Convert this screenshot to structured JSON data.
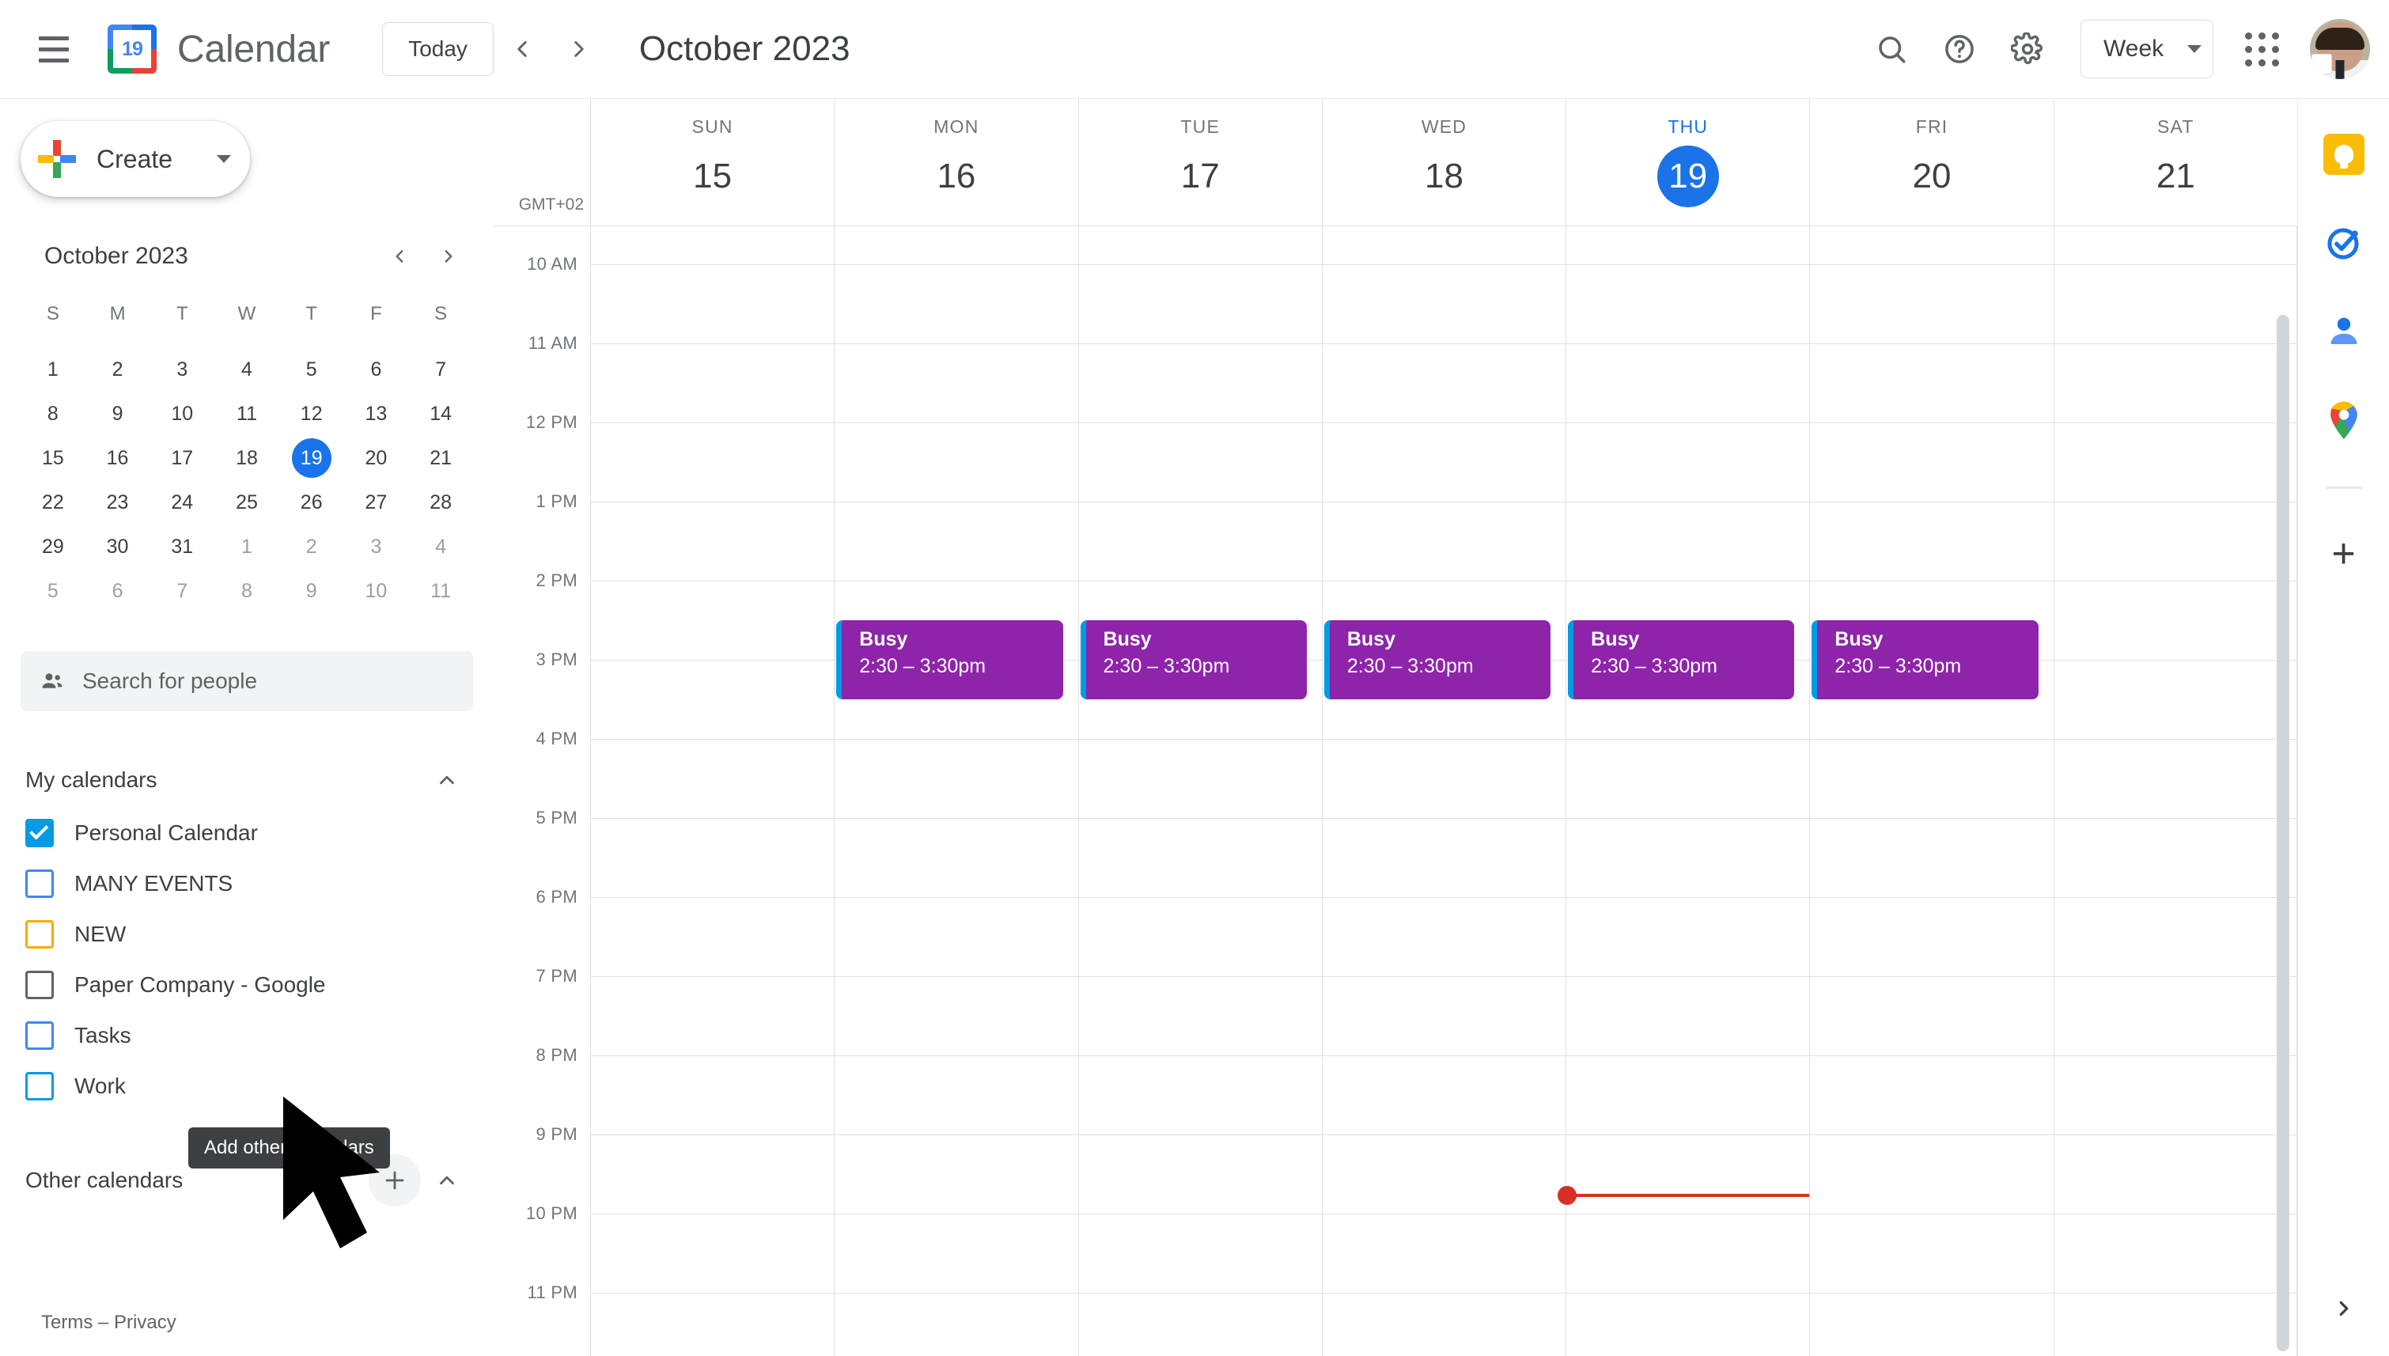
{
  "topbar": {
    "menu_icon": "hamburger-menu-icon",
    "logo_day": "19",
    "app_title": "Calendar",
    "today_label": "Today",
    "prev_label": "‹",
    "next_label": "›",
    "period_title": "October 2023",
    "search_icon": "search-icon",
    "help_icon": "help-icon",
    "settings_icon": "gear-icon",
    "view_label": "Week",
    "apps_icon": "apps-grid-icon",
    "avatar": "user-avatar"
  },
  "sidebar": {
    "create_label": "Create",
    "mini_calendar": {
      "month_label": "October 2023",
      "prev_icon": "chevron-left-icon",
      "next_icon": "chevron-right-icon",
      "dow": [
        "S",
        "M",
        "T",
        "W",
        "T",
        "F",
        "S"
      ],
      "weeks": [
        [
          {
            "d": "1",
            "muted": false
          },
          {
            "d": "2",
            "muted": false
          },
          {
            "d": "3",
            "muted": false
          },
          {
            "d": "4",
            "muted": false
          },
          {
            "d": "5",
            "muted": false
          },
          {
            "d": "6",
            "muted": false
          },
          {
            "d": "7",
            "muted": false
          }
        ],
        [
          {
            "d": "8",
            "muted": false
          },
          {
            "d": "9",
            "muted": false
          },
          {
            "d": "10",
            "muted": false
          },
          {
            "d": "11",
            "muted": false
          },
          {
            "d": "12",
            "muted": false
          },
          {
            "d": "13",
            "muted": false
          },
          {
            "d": "14",
            "muted": false
          }
        ],
        [
          {
            "d": "15",
            "muted": false
          },
          {
            "d": "16",
            "muted": false
          },
          {
            "d": "17",
            "muted": false
          },
          {
            "d": "18",
            "muted": false
          },
          {
            "d": "19",
            "muted": false,
            "today": true
          },
          {
            "d": "20",
            "muted": false
          },
          {
            "d": "21",
            "muted": false
          }
        ],
        [
          {
            "d": "22",
            "muted": false
          },
          {
            "d": "23",
            "muted": false
          },
          {
            "d": "24",
            "muted": false
          },
          {
            "d": "25",
            "muted": false
          },
          {
            "d": "26",
            "muted": false
          },
          {
            "d": "27",
            "muted": false
          },
          {
            "d": "28",
            "muted": false
          }
        ],
        [
          {
            "d": "29",
            "muted": false
          },
          {
            "d": "30",
            "muted": false
          },
          {
            "d": "31",
            "muted": false
          },
          {
            "d": "1",
            "muted": true
          },
          {
            "d": "2",
            "muted": true
          },
          {
            "d": "3",
            "muted": true
          },
          {
            "d": "4",
            "muted": true
          }
        ],
        [
          {
            "d": "5",
            "muted": true
          },
          {
            "d": "6",
            "muted": true
          },
          {
            "d": "7",
            "muted": true
          },
          {
            "d": "8",
            "muted": true
          },
          {
            "d": "9",
            "muted": true
          },
          {
            "d": "10",
            "muted": true
          },
          {
            "d": "11",
            "muted": true
          }
        ]
      ]
    },
    "search_people_placeholder": "Search for people",
    "search_people_icon": "people-icon",
    "my_calendars": {
      "title": "My calendars",
      "collapse_icon": "chevron-up-icon",
      "items": [
        {
          "label": "Personal Calendar",
          "checked": true,
          "color": "#039be5"
        },
        {
          "label": "MANY EVENTS",
          "checked": false,
          "color": "#4285f4"
        },
        {
          "label": "NEW",
          "checked": false,
          "color": "#f9ab00"
        },
        {
          "label": "Paper Company - Google",
          "checked": false,
          "color": "#5f6368"
        },
        {
          "label": "Tasks",
          "checked": false,
          "color": "#4285f4"
        },
        {
          "label": "Work",
          "checked": false,
          "color": "#039be5"
        }
      ]
    },
    "other_calendars": {
      "title": "Other calendars",
      "add_icon": "plus-icon",
      "collapse_icon": "chevron-up-icon",
      "tooltip": "Add other calendars"
    },
    "footer": "Terms – Privacy"
  },
  "calendar": {
    "timezone_label": "GMT+02",
    "days": [
      {
        "dow": "SUN",
        "num": "15",
        "today": false
      },
      {
        "dow": "MON",
        "num": "16",
        "today": false
      },
      {
        "dow": "TUE",
        "num": "17",
        "today": false
      },
      {
        "dow": "WED",
        "num": "18",
        "today": false
      },
      {
        "dow": "THU",
        "num": "19",
        "today": true
      },
      {
        "dow": "FRI",
        "num": "20",
        "today": false
      },
      {
        "dow": "SAT",
        "num": "21",
        "today": false
      }
    ],
    "hours": [
      "10 AM",
      "11 AM",
      "12 PM",
      "1 PM",
      "2 PM",
      "3 PM",
      "4 PM",
      "5 PM",
      "6 PM",
      "7 PM",
      "8 PM",
      "9 PM",
      "10 PM",
      "11 PM"
    ],
    "events": [
      {
        "title": "Busy",
        "time": "2:30 – 3:30pm",
        "day": 1,
        "start_hour": 14.5,
        "end_hour": 15.5,
        "bg": "#8e24aa",
        "stripe": "#039be5"
      },
      {
        "title": "Busy",
        "time": "2:30 – 3:30pm",
        "day": 2,
        "start_hour": 14.5,
        "end_hour": 15.5,
        "bg": "#8e24aa",
        "stripe": "#039be5"
      },
      {
        "title": "Busy",
        "time": "2:30 – 3:30pm",
        "day": 3,
        "start_hour": 14.5,
        "end_hour": 15.5,
        "bg": "#8e24aa",
        "stripe": "#039be5"
      },
      {
        "title": "Busy",
        "time": "2:30 – 3:30pm",
        "day": 4,
        "start_hour": 14.5,
        "end_hour": 15.5,
        "bg": "#8e24aa",
        "stripe": "#039be5"
      },
      {
        "title": "Busy",
        "time": "2:30 – 3:30pm",
        "day": 5,
        "start_hour": 14.5,
        "end_hour": 15.5,
        "bg": "#8e24aa",
        "stripe": "#039be5"
      }
    ],
    "now_indicator": {
      "day": 4,
      "hour": 21.75,
      "color": "#d93025"
    }
  },
  "rail": {
    "items": [
      {
        "name": "keep-icon",
        "label": "Keep"
      },
      {
        "name": "tasks-icon",
        "label": "Tasks"
      },
      {
        "name": "contacts-icon",
        "label": "Contacts"
      },
      {
        "name": "maps-icon",
        "label": "Maps"
      }
    ],
    "add_label": "+",
    "expand_icon": "chevron-right-icon"
  }
}
